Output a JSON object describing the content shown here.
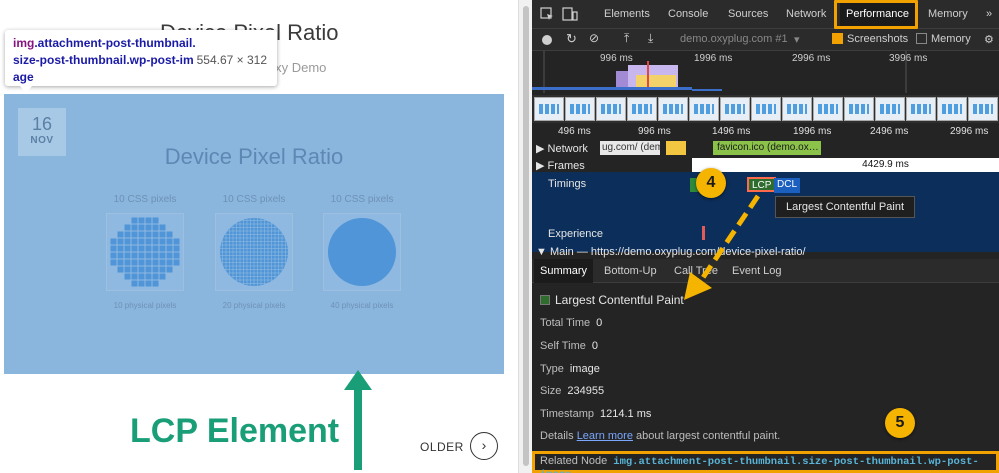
{
  "page": {
    "title": "Device Pixel Ratio",
    "subtitle": "Oxy Demo",
    "tooltip": {
      "tag": "img",
      "classes": ".attachment-post-thumbnail.size-post-thumbnail.wp-post-image",
      "dimensions": "554.67 × 312"
    },
    "thumbnail": {
      "day": "16",
      "month": "NOV",
      "title": "Device Pixel Ratio",
      "columns": [
        {
          "css_label": "10 CSS pixels",
          "physical_label": "10 physical pixels"
        },
        {
          "css_label": "10 CSS pixels",
          "physical_label": "20 physical pixels"
        },
        {
          "css_label": "10 CSS pixels",
          "physical_label": "40 physical pixels"
        }
      ]
    },
    "annotation_label": "LCP Element",
    "older_label": "OLDER",
    "older_icon": "chevron-right-icon"
  },
  "devtools": {
    "tabs": [
      "Elements",
      "Console",
      "Sources",
      "Network",
      "Performance",
      "Memory"
    ],
    "active_tab": "Performance",
    "more_icon": "double-chevron-icon",
    "toolbar": {
      "url": "demo.oxyplug.com #1",
      "screenshots_label": "Screenshots",
      "screenshots_checked": true,
      "memory_label": "Memory",
      "memory_checked": false
    },
    "overview_ticks": [
      "996 ms",
      "1996 ms",
      "2996 ms",
      "3996 ms"
    ],
    "ruler_ticks": [
      "496 ms",
      "996 ms",
      "1496 ms",
      "1996 ms",
      "2496 ms",
      "2996 ms"
    ],
    "tracks": {
      "network_label": "Network",
      "network_request_1": "ug.com/ (dem…",
      "network_request_2": "favicon.ico (demo.ox…",
      "frames_label": "Frames",
      "frames_value": "4429.9 ms",
      "timings_label": "Timings",
      "lcp_badge": "LCP",
      "dcl_badge": "DCL",
      "tooltip": "Largest Contentful Paint",
      "experience_label": "Experience",
      "main_label": "Main — https://demo.oxyplug.com/device-pixel-ratio/"
    },
    "summary_tabs": [
      "Summary",
      "Bottom-Up",
      "Call Tree",
      "Event Log"
    ],
    "active_summary_tab": "Summary",
    "summary": {
      "heading": "Largest Contentful Paint",
      "total_time_label": "Total Time",
      "total_time": "0",
      "self_time_label": "Self Time",
      "self_time": "0",
      "type_label": "Type",
      "type": "image",
      "size_label": "Size",
      "size": "234955",
      "timestamp_label": "Timestamp",
      "timestamp": "1214.1 ms",
      "details_label": "Details",
      "details_link": "Learn more",
      "details_text": "about largest contentful paint.",
      "related_label": "Related Node",
      "related_node": "img.attachment-post-thumbnail.size-post-thumbnail.wp-post-image"
    }
  },
  "callouts": [
    "4",
    "5"
  ],
  "colors": {
    "highlight": "#f2a200",
    "callout": "#f4b400",
    "lcp_green": "#1a9e78",
    "thumbnail_overlay": "#8ab6de"
  }
}
